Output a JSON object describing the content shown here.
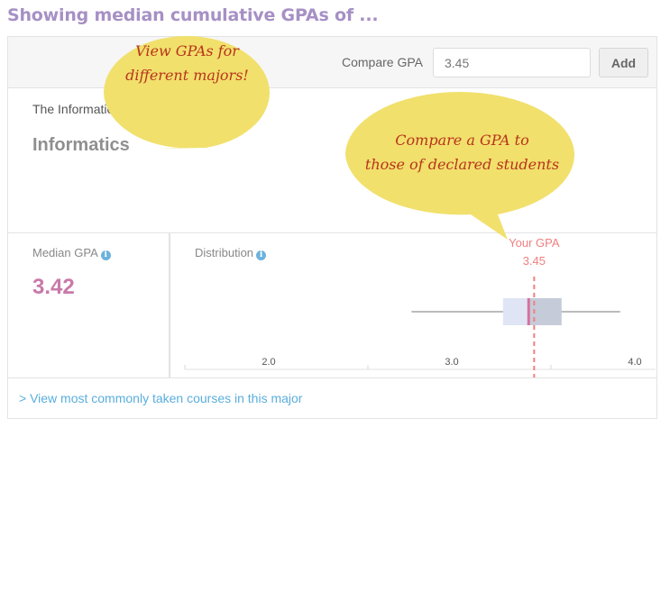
{
  "page": {
    "title": "Showing median cumulative GPAs of ..."
  },
  "toolbar": {
    "compare_label": "Compare GPA",
    "compare_input_value": "3.45",
    "add_label": "Add"
  },
  "major": {
    "school": "The Information School (Seattle campus)",
    "name": "Informatics"
  },
  "stats": {
    "median_label": "Median GPA",
    "median_value": "3.42",
    "distribution_label": "Distribution",
    "info_glyph": "i"
  },
  "distribution": {
    "axis_ticks": [
      "2.0",
      "3.0",
      "4.0"
    ],
    "whisker_low": 2.78,
    "q1": 3.28,
    "median": 3.42,
    "q3": 3.6,
    "whisker_high": 3.92,
    "your_gpa_label": "Your GPA",
    "your_gpa_value": "3.45",
    "your_gpa": 3.45,
    "colors": {
      "box_left": "#dfe5f4",
      "box_right": "#c6cbd9",
      "median_line": "#d7709c",
      "your_gpa": "#f08080",
      "whisker": "#777777"
    }
  },
  "footer": {
    "courses_link": "> View most commonly taken courses in this major"
  },
  "callouts": {
    "majors_line1": "View GPAs for",
    "majors_line2": "different majors!",
    "compare_line1": "Compare a GPA to",
    "compare_line2": "those of declared students",
    "fill_color": "#f1e06c"
  },
  "colors": {
    "title": "#a690c4",
    "median_value": "#c979a9",
    "link": "#5aaedc"
  }
}
